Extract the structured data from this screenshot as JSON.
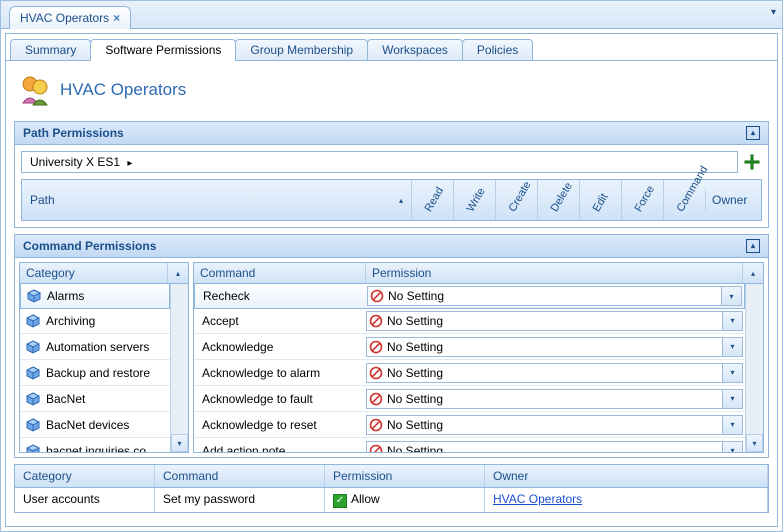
{
  "topTab": {
    "label": "HVAC Operators"
  },
  "subTabs": [
    "Summary",
    "Software Permissions",
    "Group Membership",
    "Workspaces",
    "Policies"
  ],
  "activeSubTab": 1,
  "pageTitle": "HVAC Operators",
  "pathPermissions": {
    "header": "Path Permissions",
    "breadcrumb": "University X ES1",
    "columns": {
      "path": "Path",
      "perms": [
        "Read",
        "Write",
        "Create",
        "Delete",
        "Edit",
        "Force",
        "Command"
      ],
      "owner": "Owner"
    }
  },
  "commandPermissions": {
    "header": "Command Permissions",
    "categoryHeader": "Category",
    "commandHeader": "Command",
    "permissionHeader": "Permission",
    "categories": [
      "Alarms",
      "Archiving",
      "Automation servers",
      "Backup and restore",
      "BacNet",
      "BacNet devices",
      "bacnet inquiries command"
    ],
    "selectedCategory": 0,
    "commands": [
      {
        "name": "Recheck",
        "perm": "No Setting"
      },
      {
        "name": "Accept",
        "perm": "No Setting"
      },
      {
        "name": "Acknowledge",
        "perm": "No Setting"
      },
      {
        "name": "Acknowledge to alarm",
        "perm": "No Setting"
      },
      {
        "name": "Acknowledge to fault",
        "perm": "No Setting"
      },
      {
        "name": "Acknowledge to reset",
        "perm": "No Setting"
      },
      {
        "name": "Add action note",
        "perm": "No Setting"
      }
    ]
  },
  "summaryTable": {
    "headers": {
      "category": "Category",
      "command": "Command",
      "permission": "Permission",
      "owner": "Owner"
    },
    "row": {
      "category": "User accounts",
      "command": "Set my password",
      "permission": "Allow",
      "owner": "HVAC Operators"
    }
  }
}
